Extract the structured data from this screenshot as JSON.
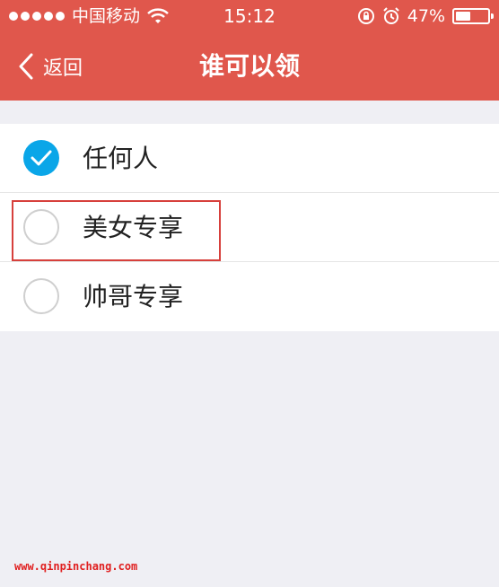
{
  "status_bar": {
    "carrier": "中国移动",
    "time": "15:12",
    "battery": "47%",
    "battery_level": 0.47
  },
  "nav": {
    "back_label": "返回",
    "title": "谁可以领"
  },
  "options": [
    {
      "label": "任何人",
      "selected": true
    },
    {
      "label": "美女专享",
      "selected": false
    },
    {
      "label": "帅哥专享",
      "selected": false
    }
  ],
  "watermark": "www.qinpinchang.com",
  "colors": {
    "header": "#e0574c",
    "check": "#0aa6e8",
    "highlight": "#d7403c"
  }
}
